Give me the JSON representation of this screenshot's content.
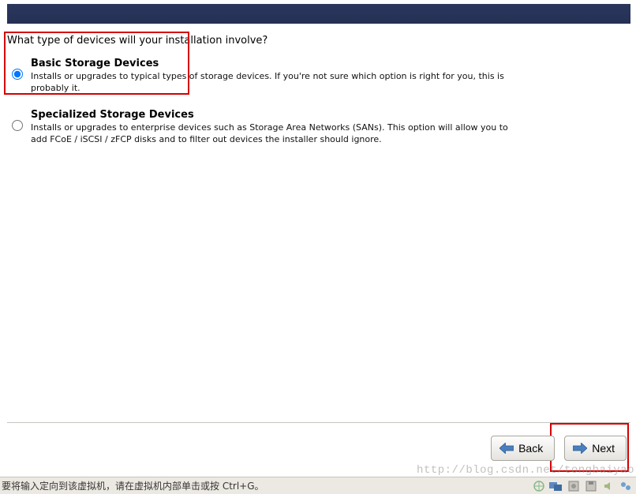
{
  "header": {},
  "prompt": "What type of devices will your installation involve?",
  "options": [
    {
      "title": "Basic Storage Devices",
      "desc": "Installs or upgrades to typical types of storage devices.  If you're not sure which option is right for you, this is probably it.",
      "selected": true
    },
    {
      "title": "Specialized Storage Devices",
      "desc": "Installs or upgrades to enterprise devices such as Storage Area Networks (SANs). This option will allow you to add FCoE / iSCSI / zFCP disks and to filter out devices the installer should ignore.",
      "selected": false
    }
  ],
  "buttons": {
    "back": "Back",
    "next": "Next"
  },
  "status_text": "要将输入定向到该虚拟机，请在虚拟机内部单击或按 Ctrl+G。",
  "watermark": "http://blog.csdn.net/tongbaiyao",
  "tray_icons": [
    "globe-icon",
    "screens-icon",
    "disk-icon",
    "floppy-icon",
    "speaker-icon",
    "net-icon"
  ]
}
